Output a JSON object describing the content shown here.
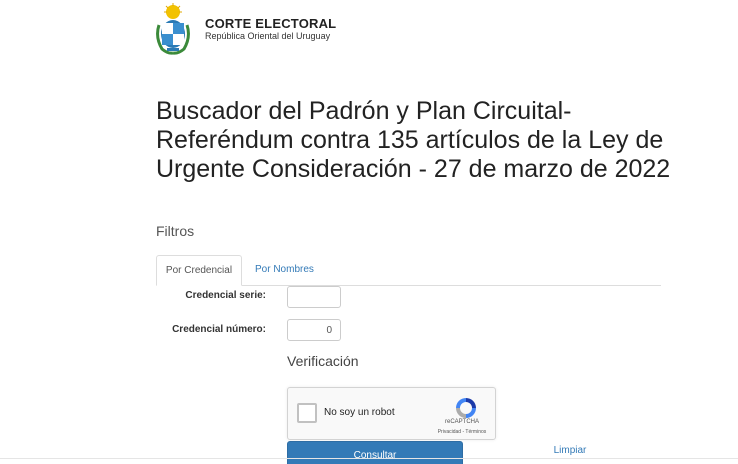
{
  "header": {
    "org_name": "CORTE ELECTORAL",
    "country": "República Oriental del Uruguay",
    "logo_icon": "uruguay-coat-of-arms-icon"
  },
  "page_title": "Buscador del Padrón y Plan Circuital- Referéndum contra 135 artículos de la Ley de Urgente Consideración - 27 de marzo de 2022",
  "filters_heading": "Filtros",
  "tabs": [
    {
      "label": "Por Credencial",
      "active": true
    },
    {
      "label": "Por Nombres",
      "active": false
    }
  ],
  "form": {
    "serie_label": "Credencial serie:",
    "serie_value": "",
    "numero_label": "Credencial número:",
    "numero_value": "0"
  },
  "verification": {
    "heading": "Verificación",
    "captcha_label": "No soy un robot",
    "captcha_brand": "reCAPTCHA",
    "captcha_links": "Privacidad - Términos"
  },
  "actions": {
    "submit_label": "Consultar",
    "clear_label": "Limpiar"
  },
  "colors": {
    "primary": "#337ab7",
    "link": "#337ab7"
  }
}
